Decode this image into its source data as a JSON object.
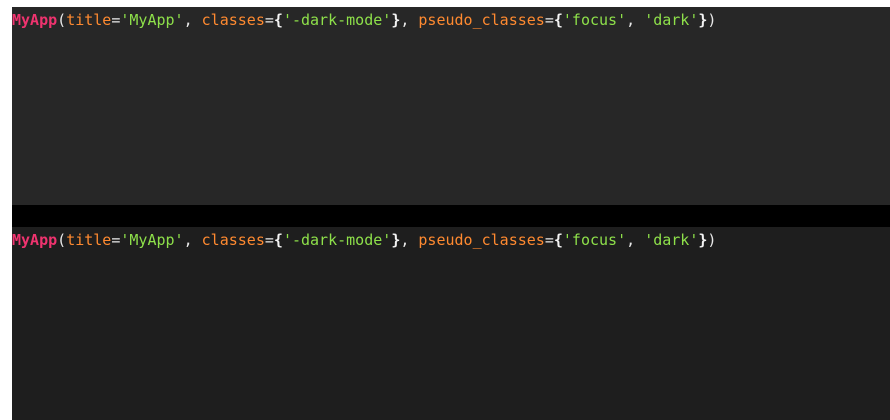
{
  "colors": {
    "class_name": "#f0336f",
    "keyword": "#ff8a30",
    "string": "#8ee04a",
    "punctuation": "#e8e8e8",
    "top_panel_bg": "#272727",
    "bottom_panel_bg": "#1e1e1e",
    "divider_bg": "#000000"
  },
  "top_panel": {
    "tokens": {
      "class_name": "MyApp",
      "open_paren": "(",
      "kw_title": "title",
      "eq1": "=",
      "str_title": "'MyApp'",
      "sep1": ", ",
      "kw_classes": "classes",
      "eq2": "=",
      "brace_open1": "{",
      "str_class": "'-dark-mode'",
      "brace_close1": "}",
      "sep2": ", ",
      "kw_pseudo": "pseudo_classes",
      "eq3": "=",
      "brace_open2": "{",
      "str_focus": "'focus'",
      "sep3": ", ",
      "str_dark": "'dark'",
      "brace_close2": "}",
      "close_paren": ")"
    }
  },
  "bottom_panel": {
    "tokens": {
      "class_name": "MyApp",
      "open_paren": "(",
      "kw_title": "title",
      "eq1": "=",
      "str_title": "'MyApp'",
      "sep1": ", ",
      "kw_classes": "classes",
      "eq2": "=",
      "brace_open1": "{",
      "str_class": "'-dark-mode'",
      "brace_close1": "}",
      "sep2": ", ",
      "kw_pseudo": "pseudo_classes",
      "eq3": "=",
      "brace_open2": "{",
      "str_focus": "'focus'",
      "sep3": ", ",
      "str_dark": "'dark'",
      "brace_close2": "}",
      "close_paren": ")"
    }
  }
}
